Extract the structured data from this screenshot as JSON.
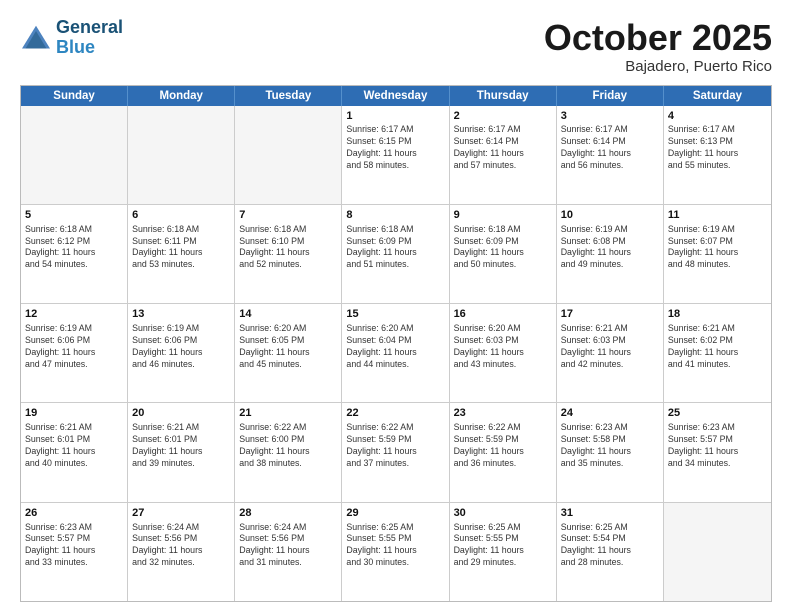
{
  "header": {
    "logo_line1": "General",
    "logo_line2": "Blue",
    "month": "October 2025",
    "location": "Bajadero, Puerto Rico"
  },
  "day_headers": [
    "Sunday",
    "Monday",
    "Tuesday",
    "Wednesday",
    "Thursday",
    "Friday",
    "Saturday"
  ],
  "weeks": [
    [
      {
        "num": "",
        "info": "",
        "empty": true
      },
      {
        "num": "",
        "info": "",
        "empty": true
      },
      {
        "num": "",
        "info": "",
        "empty": true
      },
      {
        "num": "1",
        "info": "Sunrise: 6:17 AM\nSunset: 6:15 PM\nDaylight: 11 hours\nand 58 minutes."
      },
      {
        "num": "2",
        "info": "Sunrise: 6:17 AM\nSunset: 6:14 PM\nDaylight: 11 hours\nand 57 minutes."
      },
      {
        "num": "3",
        "info": "Sunrise: 6:17 AM\nSunset: 6:14 PM\nDaylight: 11 hours\nand 56 minutes."
      },
      {
        "num": "4",
        "info": "Sunrise: 6:17 AM\nSunset: 6:13 PM\nDaylight: 11 hours\nand 55 minutes."
      }
    ],
    [
      {
        "num": "5",
        "info": "Sunrise: 6:18 AM\nSunset: 6:12 PM\nDaylight: 11 hours\nand 54 minutes."
      },
      {
        "num": "6",
        "info": "Sunrise: 6:18 AM\nSunset: 6:11 PM\nDaylight: 11 hours\nand 53 minutes."
      },
      {
        "num": "7",
        "info": "Sunrise: 6:18 AM\nSunset: 6:10 PM\nDaylight: 11 hours\nand 52 minutes."
      },
      {
        "num": "8",
        "info": "Sunrise: 6:18 AM\nSunset: 6:09 PM\nDaylight: 11 hours\nand 51 minutes."
      },
      {
        "num": "9",
        "info": "Sunrise: 6:18 AM\nSunset: 6:09 PM\nDaylight: 11 hours\nand 50 minutes."
      },
      {
        "num": "10",
        "info": "Sunrise: 6:19 AM\nSunset: 6:08 PM\nDaylight: 11 hours\nand 49 minutes."
      },
      {
        "num": "11",
        "info": "Sunrise: 6:19 AM\nSunset: 6:07 PM\nDaylight: 11 hours\nand 48 minutes."
      }
    ],
    [
      {
        "num": "12",
        "info": "Sunrise: 6:19 AM\nSunset: 6:06 PM\nDaylight: 11 hours\nand 47 minutes."
      },
      {
        "num": "13",
        "info": "Sunrise: 6:19 AM\nSunset: 6:06 PM\nDaylight: 11 hours\nand 46 minutes."
      },
      {
        "num": "14",
        "info": "Sunrise: 6:20 AM\nSunset: 6:05 PM\nDaylight: 11 hours\nand 45 minutes."
      },
      {
        "num": "15",
        "info": "Sunrise: 6:20 AM\nSunset: 6:04 PM\nDaylight: 11 hours\nand 44 minutes."
      },
      {
        "num": "16",
        "info": "Sunrise: 6:20 AM\nSunset: 6:03 PM\nDaylight: 11 hours\nand 43 minutes."
      },
      {
        "num": "17",
        "info": "Sunrise: 6:21 AM\nSunset: 6:03 PM\nDaylight: 11 hours\nand 42 minutes."
      },
      {
        "num": "18",
        "info": "Sunrise: 6:21 AM\nSunset: 6:02 PM\nDaylight: 11 hours\nand 41 minutes."
      }
    ],
    [
      {
        "num": "19",
        "info": "Sunrise: 6:21 AM\nSunset: 6:01 PM\nDaylight: 11 hours\nand 40 minutes."
      },
      {
        "num": "20",
        "info": "Sunrise: 6:21 AM\nSunset: 6:01 PM\nDaylight: 11 hours\nand 39 minutes."
      },
      {
        "num": "21",
        "info": "Sunrise: 6:22 AM\nSunset: 6:00 PM\nDaylight: 11 hours\nand 38 minutes."
      },
      {
        "num": "22",
        "info": "Sunrise: 6:22 AM\nSunset: 5:59 PM\nDaylight: 11 hours\nand 37 minutes."
      },
      {
        "num": "23",
        "info": "Sunrise: 6:22 AM\nSunset: 5:59 PM\nDaylight: 11 hours\nand 36 minutes."
      },
      {
        "num": "24",
        "info": "Sunrise: 6:23 AM\nSunset: 5:58 PM\nDaylight: 11 hours\nand 35 minutes."
      },
      {
        "num": "25",
        "info": "Sunrise: 6:23 AM\nSunset: 5:57 PM\nDaylight: 11 hours\nand 34 minutes."
      }
    ],
    [
      {
        "num": "26",
        "info": "Sunrise: 6:23 AM\nSunset: 5:57 PM\nDaylight: 11 hours\nand 33 minutes."
      },
      {
        "num": "27",
        "info": "Sunrise: 6:24 AM\nSunset: 5:56 PM\nDaylight: 11 hours\nand 32 minutes."
      },
      {
        "num": "28",
        "info": "Sunrise: 6:24 AM\nSunset: 5:56 PM\nDaylight: 11 hours\nand 31 minutes."
      },
      {
        "num": "29",
        "info": "Sunrise: 6:25 AM\nSunset: 5:55 PM\nDaylight: 11 hours\nand 30 minutes."
      },
      {
        "num": "30",
        "info": "Sunrise: 6:25 AM\nSunset: 5:55 PM\nDaylight: 11 hours\nand 29 minutes."
      },
      {
        "num": "31",
        "info": "Sunrise: 6:25 AM\nSunset: 5:54 PM\nDaylight: 11 hours\nand 28 minutes."
      },
      {
        "num": "",
        "info": "",
        "empty": true
      }
    ]
  ]
}
